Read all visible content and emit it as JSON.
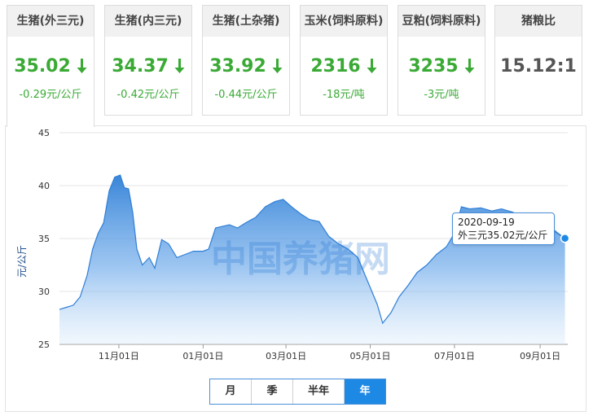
{
  "cards": [
    {
      "title": "生猪(外三元)",
      "price": "35.02",
      "change": "-0.29元/公斤",
      "trend": "down",
      "active": true
    },
    {
      "title": "生猪(内三元)",
      "price": "34.37",
      "change": "-0.42元/公斤",
      "trend": "down"
    },
    {
      "title": "生猪(土杂猪)",
      "price": "33.92",
      "change": "-0.44元/公斤",
      "trend": "down"
    },
    {
      "title": "玉米(饲料原料)",
      "price": "2316",
      "change": "-18元/吨",
      "trend": "down"
    },
    {
      "title": "豆粕(饲料原料)",
      "price": "3235",
      "change": "-3元/吨",
      "trend": "down"
    },
    {
      "title": "猪粮比",
      "price": "15.12:1",
      "change": "",
      "trend": "none"
    }
  ],
  "watermark": "中国养猪网",
  "tooltip": {
    "date": "2020-09-19",
    "text": "外三元35.02元/公斤"
  },
  "range_buttons": [
    {
      "label": "月",
      "selected": false
    },
    {
      "label": "季",
      "selected": false
    },
    {
      "label": "半年",
      "selected": false
    },
    {
      "label": "年",
      "selected": true
    }
  ],
  "colors": {
    "accent": "#1e88e5",
    "down": "#3aaa35",
    "line": "#2f7fd6"
  },
  "chart_data": {
    "type": "area",
    "ylabel": "元/公斤",
    "ylim": [
      25,
      45
    ],
    "yticks": [
      25,
      30,
      35,
      40,
      45
    ],
    "xlim": [
      "2019-09-19",
      "2020-09-21"
    ],
    "xticks": [
      {
        "label": "11月01日",
        "date": "2019-11-01"
      },
      {
        "label": "01月01日",
        "date": "2020-01-01"
      },
      {
        "label": "03月01日",
        "date": "2020-03-01"
      },
      {
        "label": "05月01日",
        "date": "2020-05-01"
      },
      {
        "label": "07月01日",
        "date": "2020-07-01"
      },
      {
        "label": "09月01日",
        "date": "2020-09-01"
      }
    ],
    "grid": true,
    "series": [
      {
        "name": "外三元",
        "points": [
          [
            "2019-09-19",
            28.3
          ],
          [
            "2019-09-24",
            28.5
          ],
          [
            "2019-09-29",
            28.7
          ],
          [
            "2019-10-04",
            29.5
          ],
          [
            "2019-10-09",
            31.5
          ],
          [
            "2019-10-13",
            34.0
          ],
          [
            "2019-10-17",
            35.5
          ],
          [
            "2019-10-21",
            36.5
          ],
          [
            "2019-10-25",
            39.5
          ],
          [
            "2019-10-29",
            40.8
          ],
          [
            "2019-11-02",
            41.0
          ],
          [
            "2019-11-05",
            39.8
          ],
          [
            "2019-11-08",
            39.7
          ],
          [
            "2019-11-11",
            37.5
          ],
          [
            "2019-11-14",
            34.0
          ],
          [
            "2019-11-18",
            32.5
          ],
          [
            "2019-11-23",
            33.2
          ],
          [
            "2019-11-27",
            32.2
          ],
          [
            "2019-12-02",
            34.9
          ],
          [
            "2019-12-07",
            34.5
          ],
          [
            "2019-12-13",
            33.2
          ],
          [
            "2019-12-19",
            33.5
          ],
          [
            "2019-12-25",
            33.8
          ],
          [
            "2020-01-01",
            33.8
          ],
          [
            "2020-01-05",
            34.0
          ],
          [
            "2020-01-10",
            36.0
          ],
          [
            "2020-01-20",
            36.3
          ],
          [
            "2020-01-26",
            36.0
          ],
          [
            "2020-02-01",
            36.5
          ],
          [
            "2020-02-08",
            37.0
          ],
          [
            "2020-02-15",
            38.0
          ],
          [
            "2020-02-22",
            38.5
          ],
          [
            "2020-02-28",
            38.7
          ],
          [
            "2020-03-05",
            38.0
          ],
          [
            "2020-03-12",
            37.3
          ],
          [
            "2020-03-18",
            36.8
          ],
          [
            "2020-03-25",
            36.6
          ],
          [
            "2020-04-01",
            35.2
          ],
          [
            "2020-04-08",
            34.5
          ],
          [
            "2020-04-15",
            34.0
          ],
          [
            "2020-04-22",
            33.2
          ],
          [
            "2020-04-29",
            31.0
          ],
          [
            "2020-05-06",
            28.8
          ],
          [
            "2020-05-10",
            27.0
          ],
          [
            "2020-05-16",
            28.0
          ],
          [
            "2020-05-22",
            29.5
          ],
          [
            "2020-05-28",
            30.5
          ],
          [
            "2020-06-04",
            31.8
          ],
          [
            "2020-06-11",
            32.5
          ],
          [
            "2020-06-18",
            33.5
          ],
          [
            "2020-06-25",
            34.2
          ],
          [
            "2020-07-01",
            35.5
          ],
          [
            "2020-07-06",
            38.0
          ],
          [
            "2020-07-12",
            37.8
          ],
          [
            "2020-07-20",
            37.9
          ],
          [
            "2020-07-28",
            37.6
          ],
          [
            "2020-08-04",
            37.8
          ],
          [
            "2020-08-12",
            37.5
          ],
          [
            "2020-08-19",
            37.0
          ],
          [
            "2020-08-26",
            36.8
          ],
          [
            "2020-09-02",
            36.6
          ],
          [
            "2020-09-09",
            36.0
          ],
          [
            "2020-09-14",
            35.5
          ],
          [
            "2020-09-19",
            35.02
          ]
        ]
      }
    ]
  }
}
